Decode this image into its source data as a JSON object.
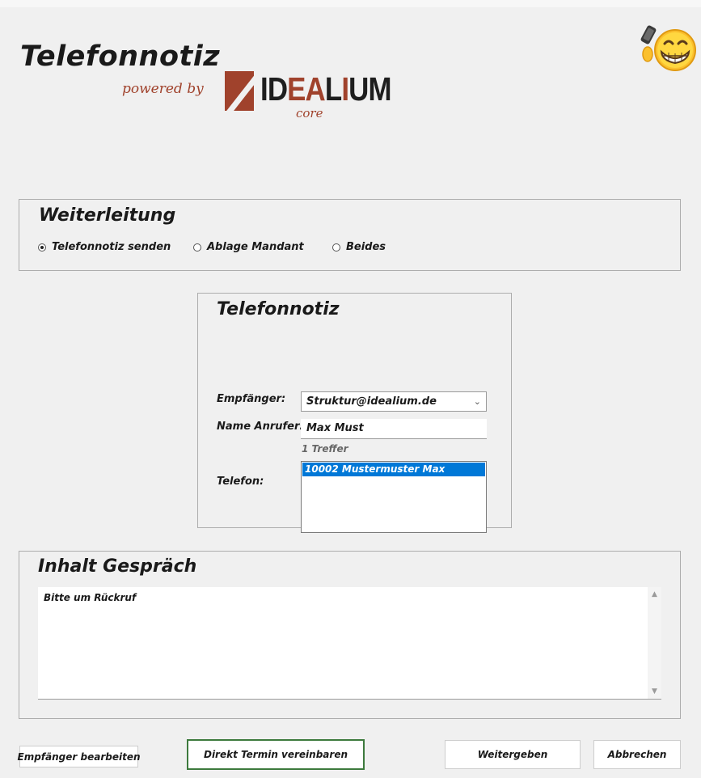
{
  "app": {
    "title": "Telefonnotiz",
    "powered_by": "powered by",
    "logo_text_id": "ID",
    "logo_text_ea": "EA",
    "logo_text_l": "L",
    "logo_text_i": "I",
    "logo_text_um": "UM",
    "logo_sub": "core"
  },
  "weiterleitung": {
    "title": "Weiterleitung",
    "options": [
      {
        "label": "Telefonnotiz senden",
        "checked": true
      },
      {
        "label": "Ablage Mandant",
        "checked": false
      },
      {
        "label": "Beides",
        "checked": false
      }
    ]
  },
  "telefonnotiz": {
    "title": "Telefonnotiz",
    "empfaenger_label": "Empfänger:",
    "empfaenger_value": "Struktur@idealium.de",
    "name_label": "Name Anrufer:",
    "name_value": "Max Must",
    "hits": "1 Treffer",
    "telefon_label": "Telefon:",
    "results": [
      "10002 Mustermuster Max"
    ]
  },
  "inhalt": {
    "title": "Inhalt Gespräch",
    "text": "Bitte um Rückruf"
  },
  "buttons": {
    "edit_recipients": "Empfänger bearbeiten",
    "schedule": "Direkt Termin vereinbaren",
    "forward": "Weitergeben",
    "cancel": "Abbrechen"
  },
  "colors": {
    "accent": "#a0422c",
    "selection": "#0078d7",
    "schedule_border": "#3d7a3d"
  }
}
